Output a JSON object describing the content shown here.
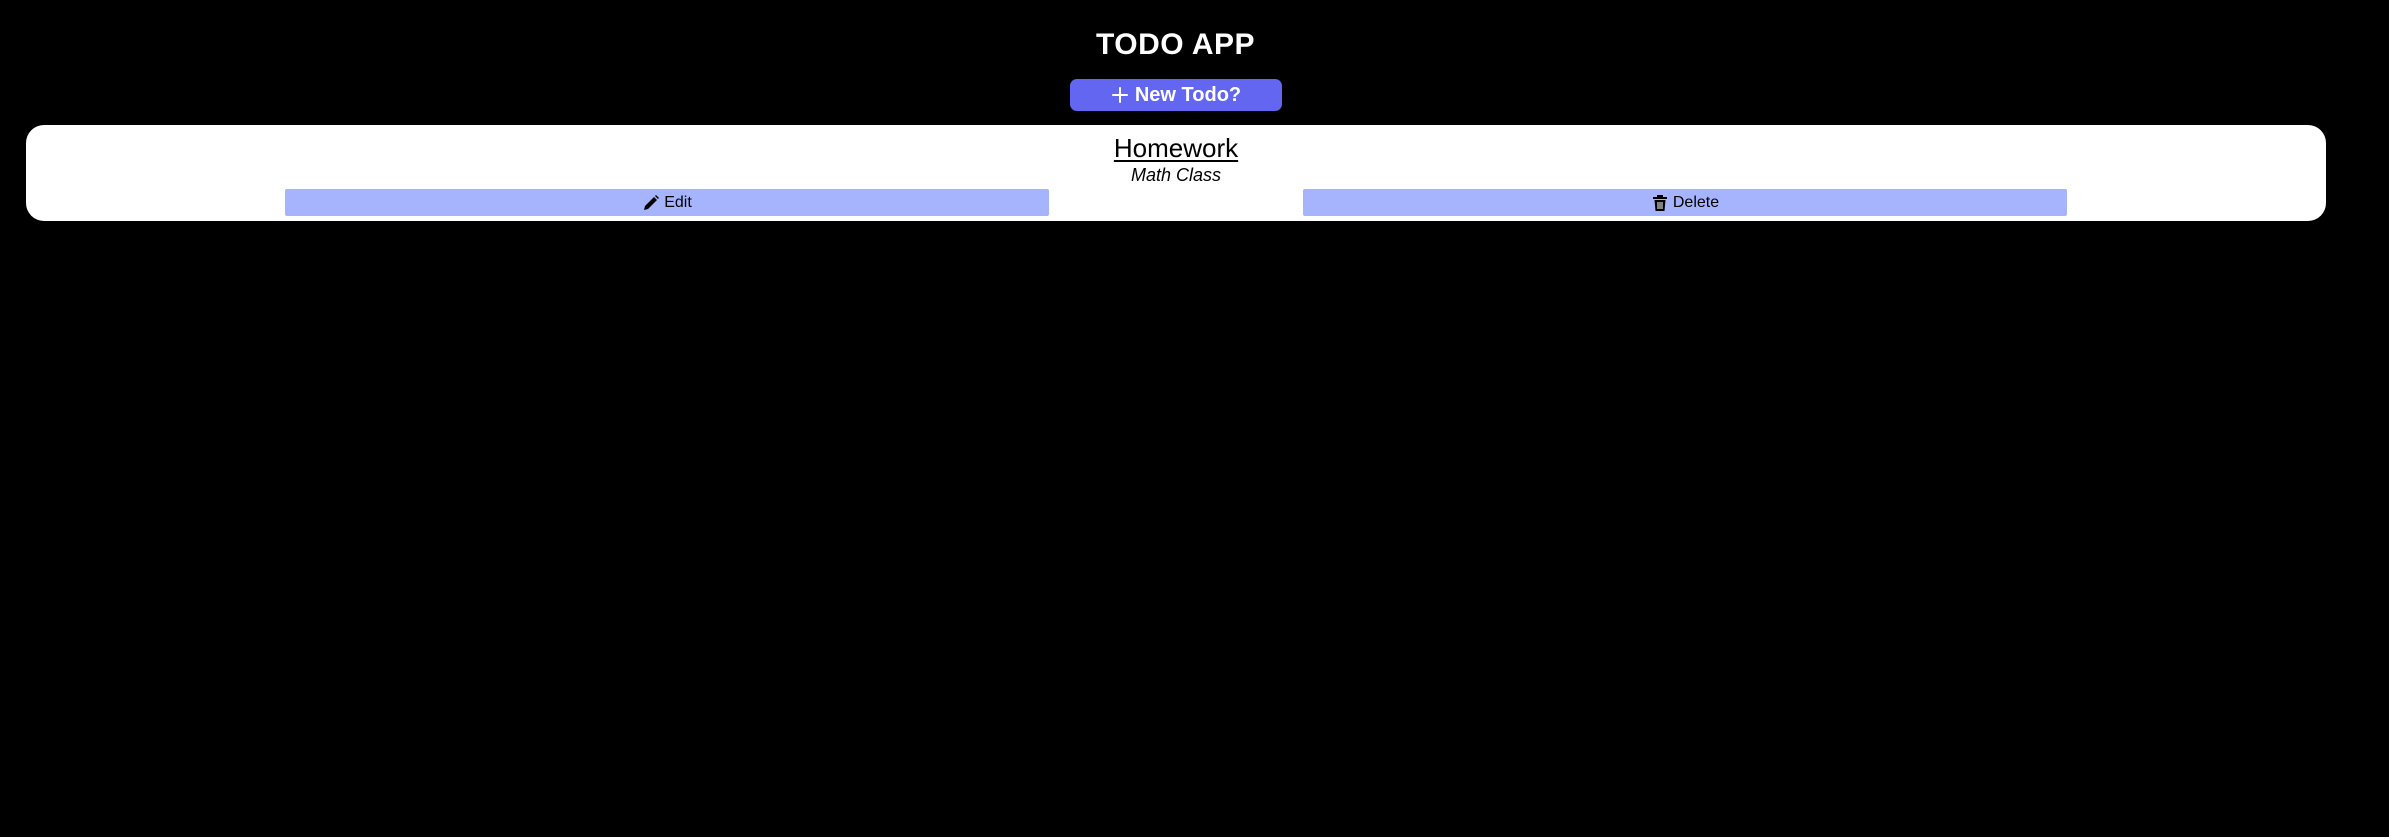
{
  "app": {
    "title": "TODO APP"
  },
  "toolbar": {
    "new_todo_label": "New Todo?",
    "new_todo_icon": "plus-icon"
  },
  "todos": [
    {
      "title": "Homework",
      "description": "Math Class",
      "edit_label": "Edit",
      "edit_icon": "pencil-icon",
      "delete_label": "Delete",
      "delete_icon": "trash-icon"
    }
  ],
  "colors": {
    "background": "#000000",
    "accent": "#6366f1",
    "action_button": "#a5b4fc",
    "card": "#ffffff"
  }
}
